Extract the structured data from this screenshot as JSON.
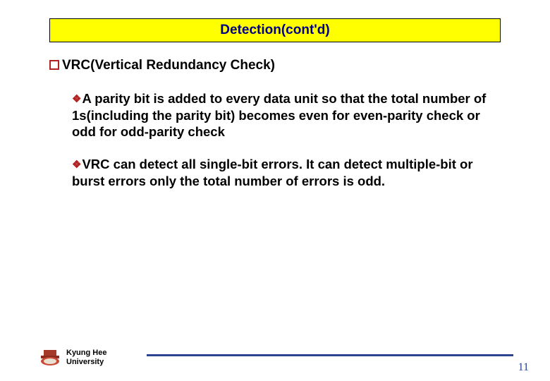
{
  "title": "Detection(cont'd)",
  "heading": "VRC(Vertical Redundancy Check)",
  "bullets": [
    "A parity bit is added to every data unit so that the total number of 1s(including the parity bit) becomes even for even-parity check or odd for odd-parity check",
    "VRC can detect all single-bit errors. It can detect multiple-bit or burst errors only the total number of errors is odd."
  ],
  "footer": {
    "line1": "Kyung Hee",
    "line2": "University"
  },
  "page_number": "11"
}
